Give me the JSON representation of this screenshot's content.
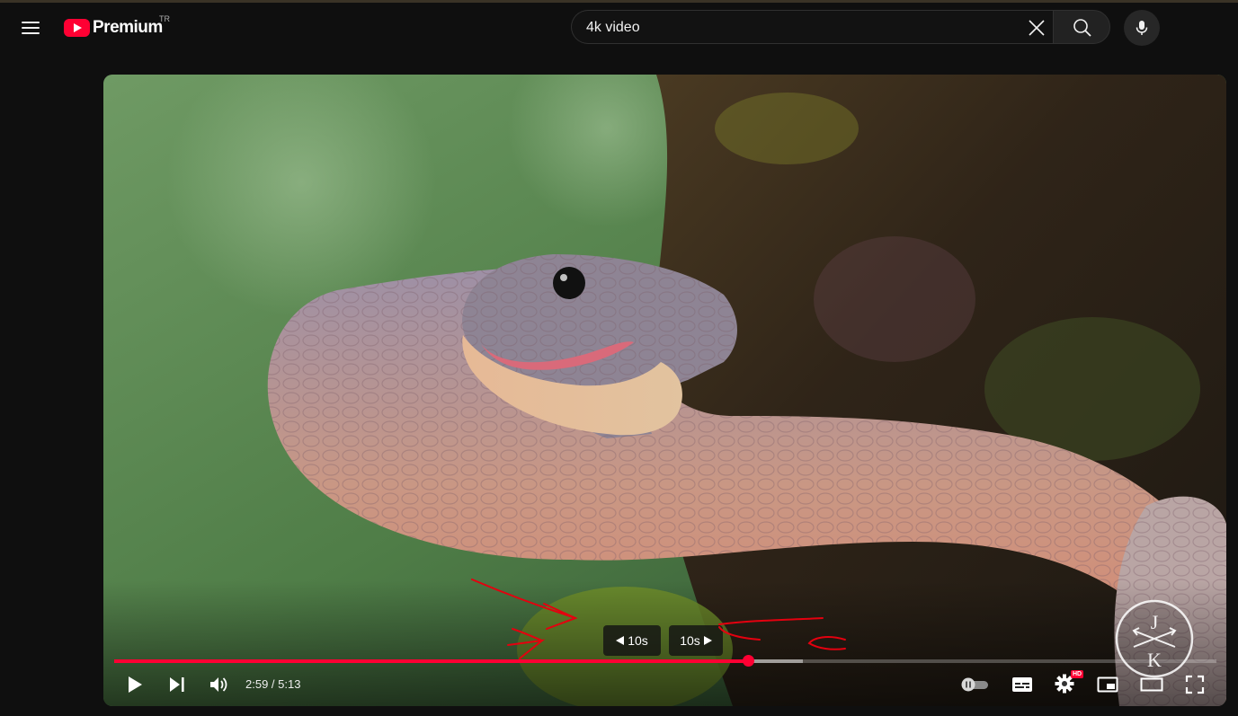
{
  "header": {
    "menu_icon": "hamburger-menu-icon",
    "logo_text": "Premium",
    "logo_region": "TR",
    "search_value": "4k video",
    "clear_icon": "close-icon",
    "search_icon": "search-icon",
    "mic_icon": "microphone-icon"
  },
  "player": {
    "seek_back_label": "10s",
    "seek_forward_label": "10s",
    "time_display": "2:59 / 5:13",
    "current_time": "2:59",
    "duration": "5:13",
    "progress_played": 0.575,
    "progress_buffered": 0.625,
    "hd_badge": "HD",
    "accent_color": "#ff0033",
    "watermark_letters": [
      "J",
      "K"
    ],
    "icons": [
      "play-icon",
      "next-icon",
      "volume-icon",
      "autoplay-toggle-icon",
      "subtitles-icon",
      "settings-icon",
      "miniplayer-icon",
      "theater-mode-icon",
      "fullscreen-icon"
    ]
  }
}
